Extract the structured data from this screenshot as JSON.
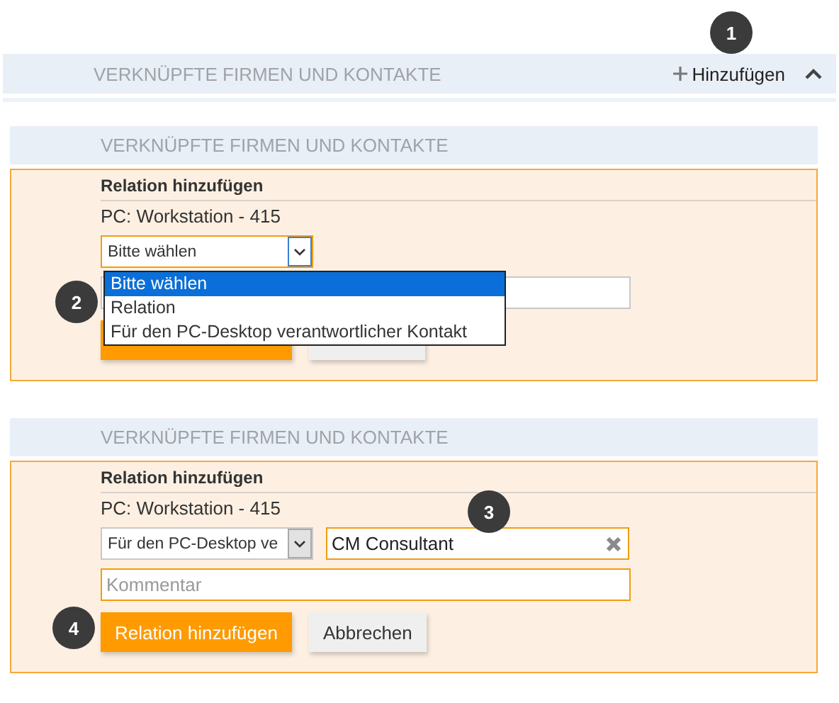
{
  "top_section": {
    "title": "VERKNÜPFTE FIRMEN UND KONTAKTE",
    "add_label": "Hinzufügen",
    "expanded": true
  },
  "forms": [
    {
      "header": "VERKNÜPFTE FIRMEN UND KONTAKTE",
      "title": "Relation hinzufügen",
      "subtitle": "PC: Workstation - 415",
      "select": {
        "value": "Bitte wählen",
        "focused": true,
        "open": true,
        "options": [
          {
            "label": "Bitte wählen",
            "selected": true
          },
          {
            "label": "Relation",
            "selected": false
          },
          {
            "label": "Für den PC-Desktop verantwortlicher Kontakt",
            "selected": false
          }
        ]
      },
      "comment_field": {
        "focused": false
      },
      "buttons": [
        {
          "kind": "primary"
        },
        {
          "kind": "secondary"
        }
      ]
    },
    {
      "header": "VERKNÜPFTE FIRMEN UND KONTAKTE",
      "title": "Relation hinzufügen",
      "subtitle": "PC: Workstation - 415",
      "select": {
        "value": "Für den PC-Desktop ve",
        "focused": false,
        "open": false
      },
      "contact_field": {
        "value": "CM Consultant",
        "focused": true,
        "clearable": true
      },
      "comment_field": {
        "placeholder": "Kommentar",
        "focused": true
      },
      "buttons": [
        {
          "label": "Relation hinzufügen",
          "kind": "primary"
        },
        {
          "label": "Abbrechen",
          "kind": "secondary"
        }
      ]
    }
  ],
  "callouts": [
    {
      "label": "1"
    },
    {
      "label": "2"
    },
    {
      "label": "3"
    },
    {
      "label": "4"
    }
  ]
}
